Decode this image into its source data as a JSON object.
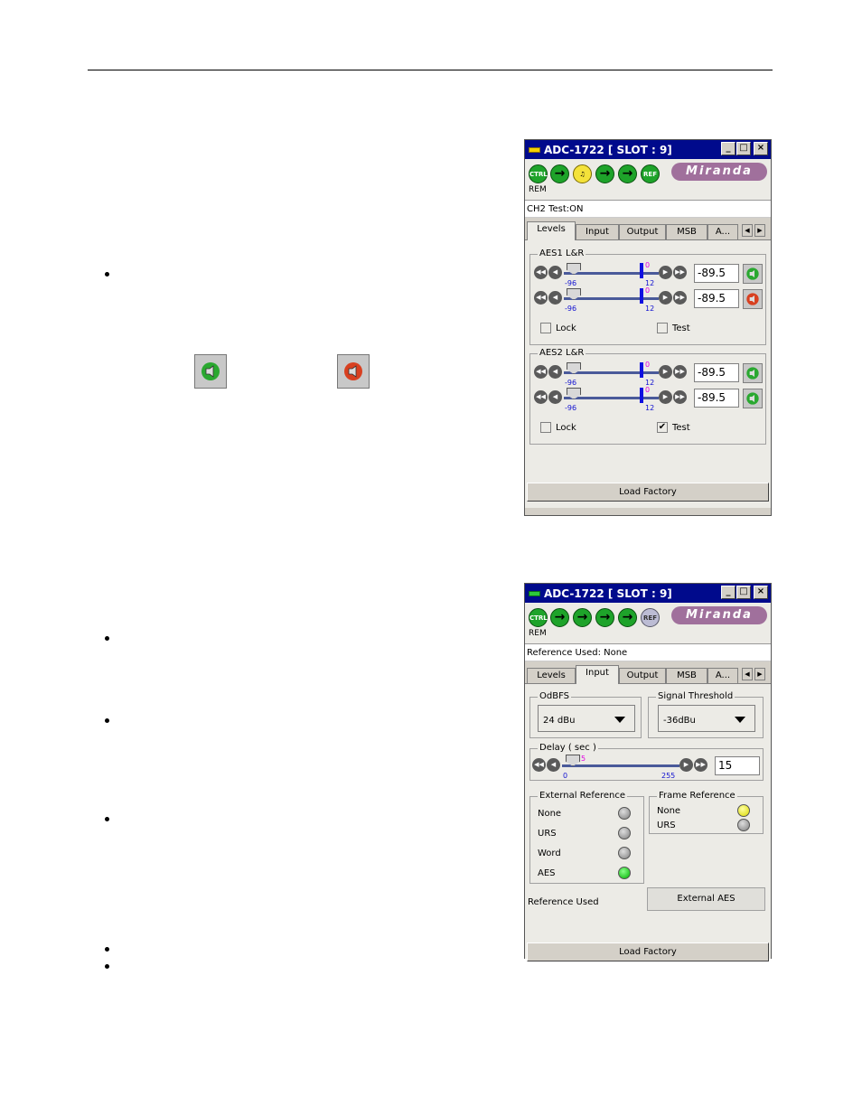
{
  "window1": {
    "title": "ADC-1722 [ SLOT : 9]",
    "rem": "REM",
    "status": "CH2 Test:ON",
    "logo": "Miranda",
    "icons": {
      "ctrl": "CTRL",
      "ref": "REF"
    },
    "tabs": [
      "Levels",
      "Input",
      "Output",
      "MSB",
      "A..."
    ],
    "active_tab": "Levels",
    "groups": [
      {
        "label": "AES1 L&R",
        "rows": [
          {
            "value": "-89.5",
            "min": "-96",
            "max": "12",
            "peak": "0"
          },
          {
            "value": "-89.5",
            "min": "-96",
            "max": "12",
            "peak": "0"
          }
        ],
        "lock": "Lock",
        "lock_checked": false,
        "test": "Test",
        "test_checked": false
      },
      {
        "label": "AES2 L&R",
        "rows": [
          {
            "value": "-89.5",
            "min": "-96",
            "max": "12",
            "peak": "0"
          },
          {
            "value": "-89.5",
            "min": "-96",
            "max": "12",
            "peak": "0"
          }
        ],
        "lock": "Lock",
        "lock_checked": false,
        "test": "Test",
        "test_checked": true,
        "test_mark": "✔"
      }
    ],
    "load_factory": "Load Factory"
  },
  "window2": {
    "title": "ADC-1722 [ SLOT : 9]",
    "rem": "REM",
    "status": "Reference Used: None",
    "logo": "Miranda",
    "icons": {
      "ctrl": "CTRL",
      "ref": "REF"
    },
    "tabs": [
      "Levels",
      "Input",
      "Output",
      "MSB",
      "A..."
    ],
    "active_tab": "Input",
    "odbfs": {
      "label": "OdBFS",
      "value": "24 dBu"
    },
    "signal_threshold": {
      "label": "Signal Threshold",
      "value": "-36dBu"
    },
    "delay": {
      "label": "Delay ( sec )",
      "value": "15",
      "min": "0",
      "max": "255",
      "current": "5"
    },
    "external_reference": {
      "label": "External Reference",
      "items": [
        {
          "name": "None",
          "state": "grey"
        },
        {
          "name": "URS",
          "state": "grey"
        },
        {
          "name": "Word",
          "state": "grey"
        },
        {
          "name": "AES",
          "state": "green"
        }
      ]
    },
    "frame_reference": {
      "label": "Frame Reference",
      "items": [
        {
          "name": "None",
          "state": "yellow"
        },
        {
          "name": "URS",
          "state": "grey"
        }
      ]
    },
    "reference_used_label": "Reference Used",
    "reference_used_value": "External AES",
    "load_factory": "Load Factory"
  }
}
